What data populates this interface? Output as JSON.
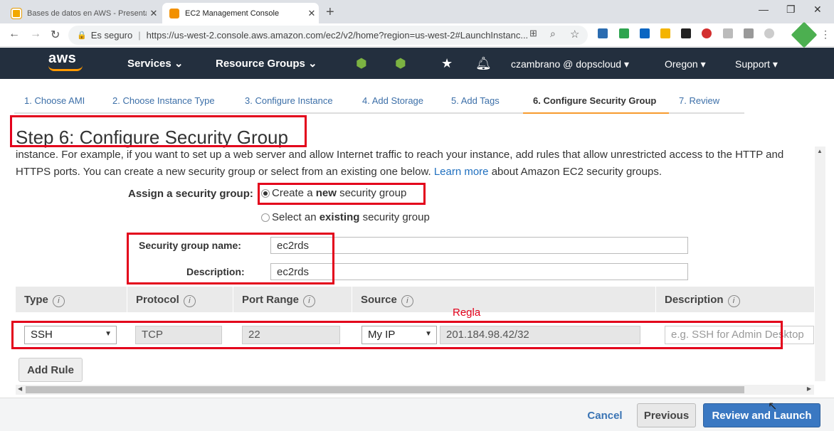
{
  "browser": {
    "tabs": [
      {
        "title": "Bases de datos en AWS - Presentación",
        "active": false
      },
      {
        "title": "EC2 Management Console",
        "active": true
      }
    ],
    "url_secure_label": "Es seguro",
    "url": "https://us-west-2.console.aws.amazon.com/ec2/v2/home?region=us-west-2#LaunchInstanc..."
  },
  "aws_nav": {
    "logo": "aws",
    "services": "Services",
    "resource_groups": "Resource Groups",
    "user": "czambrano @ dopscloud",
    "region": "Oregon",
    "support": "Support",
    "bar_color": "#232f3e",
    "accent_color": "#ff9900"
  },
  "wizard": {
    "steps": [
      "1. Choose AMI",
      "2. Choose Instance Type",
      "3. Configure Instance",
      "4. Add Storage",
      "5. Add Tags",
      "6. Configure Security Group",
      "7. Review"
    ],
    "active_step": "6. Configure Security Group",
    "title": "Step 6: Configure Security Group",
    "intro_part1": "instance. For example, if you want to set up a web server and allow Internet traffic to reach your instance, add rules that allow unrestricted access to the HTTP and HTTPS ports. You can create a new security group or select from an existing one below.",
    "intro_link": "Learn more",
    "intro_part2": "about Amazon EC2 security groups.",
    "assign_label": "Assign a security group:",
    "option_create_pre": "Create a",
    "option_create_bold": "new",
    "option_create_post": "security group",
    "option_select_pre": "Select an",
    "option_select_bold": "existing",
    "option_select_post": "security group",
    "sg_name_label": "Security group name:",
    "sg_name_value": "ec2rds",
    "description_label": "Description:",
    "description_value": "ec2rds"
  },
  "rules_table": {
    "headers": [
      "Type",
      "Protocol",
      "Port Range",
      "Source",
      "Description"
    ],
    "row": {
      "type": "SSH",
      "protocol": "TCP",
      "port_range": "22",
      "source_mode": "My IP",
      "source_cidr": "201.184.98.42/32",
      "description_placeholder": "e.g. SSH for Admin Desktop"
    },
    "add_rule": "Add Rule"
  },
  "footer": {
    "cancel": "Cancel",
    "previous": "Previous",
    "review_launch": "Review and Launch"
  },
  "annotation": {
    "rule_label": "Regla",
    "color": "#e3001b"
  }
}
